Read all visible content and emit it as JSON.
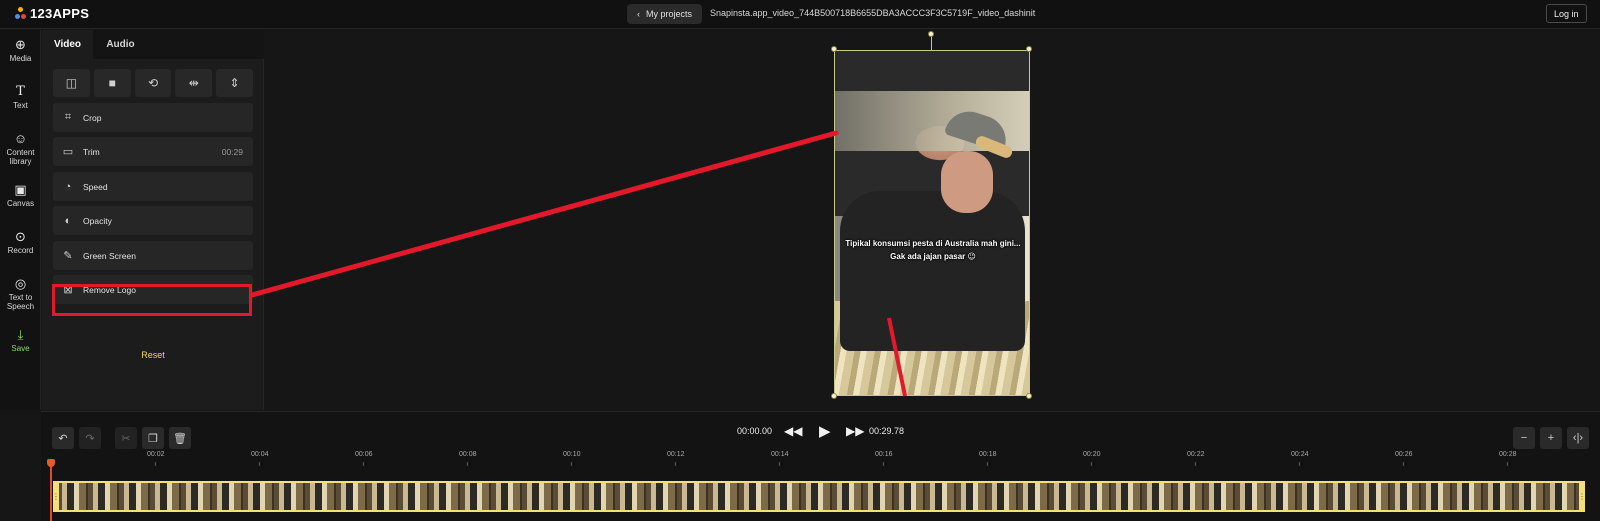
{
  "header": {
    "logo_text": "123APPS",
    "my_projects_label": "My projects",
    "file_name": "Snapinsta.app_video_744B500718B6655DBA3ACCC3F3C5719F_video_dashinit",
    "login_label": "Log in"
  },
  "rail": {
    "media": "Media",
    "text": "Text",
    "content_library": "Content library",
    "canvas": "Canvas",
    "record": "Record",
    "tts": "Text to Speech",
    "save": "Save"
  },
  "panel": {
    "tabs": {
      "video": "Video",
      "audio": "Audio"
    },
    "options": {
      "crop": "Crop",
      "trim": "Trim",
      "trim_duration": "00:29",
      "speed": "Speed",
      "opacity": "Opacity",
      "green_screen": "Green Screen",
      "remove_logo": "Remove Logo"
    },
    "reset_label": "Reset"
  },
  "video": {
    "caption_line1": "Tipikal konsumsi pesta di Australia mah gini...",
    "caption_line2": "Gak ada jajan pasar 😉"
  },
  "playback": {
    "current_time": "00:00.00",
    "total_time": "00:29.78"
  },
  "timeline": {
    "ruler": [
      "00:02",
      "00:04",
      "00:06",
      "00:08",
      "00:10",
      "00:12",
      "00:14",
      "00:16",
      "00:18",
      "00:20",
      "00:22",
      "00:24",
      "00:26",
      "00:28"
    ]
  },
  "colors": {
    "annotation_red": "#e3182a",
    "save_green": "#84d96a",
    "reset_yellow": "#f0d66a",
    "track_border": "#f4e07a"
  }
}
